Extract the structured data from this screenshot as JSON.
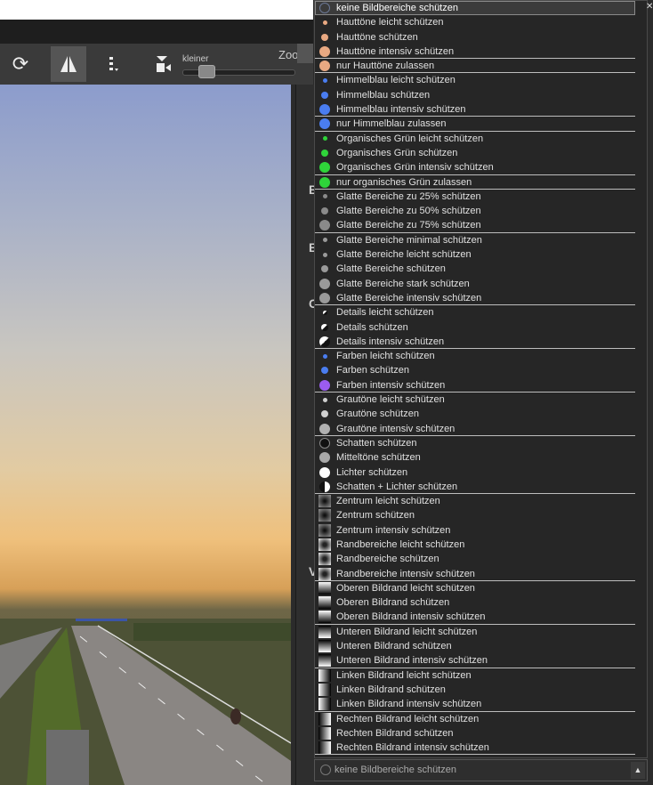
{
  "toolbar": {
    "slider_label": "kleiner",
    "zoom_label": "Zoo"
  },
  "side_letters": [
    "B",
    "E",
    "C",
    "V"
  ],
  "dropdown": {
    "selected_index": 0,
    "items": [
      {
        "label": "keine Bildbereiche schützen",
        "icon": "none-icon",
        "color": "#6b7896",
        "sep": true
      },
      {
        "label": "Hauttöne leicht schützen",
        "icon": "skin-small-icon",
        "color": "#e9a982"
      },
      {
        "label": "Hauttöne schützen",
        "icon": "skin-medium-icon",
        "color": "#e9a982"
      },
      {
        "label": "Hauttöne intensiv schützen",
        "icon": "skin-large-icon",
        "color": "#e9a982",
        "sep": true
      },
      {
        "label": "nur Hauttöne zulassen",
        "icon": "skin-only-icon",
        "color": "#e9a982",
        "sep": true
      },
      {
        "label": "Himmelblau leicht schützen",
        "icon": "sky-small-icon",
        "color": "#4a7df0"
      },
      {
        "label": "Himmelblau schützen",
        "icon": "sky-medium-icon",
        "color": "#4a7df0"
      },
      {
        "label": "Himmelblau intensiv schützen",
        "icon": "sky-large-icon",
        "color": "#4a7df0",
        "sep": true
      },
      {
        "label": "nur Himmelblau zulassen",
        "icon": "sky-only-icon",
        "color": "#4a7df0",
        "sep": true
      },
      {
        "label": "Organisches Grün leicht schützen",
        "icon": "green-small-icon",
        "color": "#2fd43a"
      },
      {
        "label": "Organisches Grün schützen",
        "icon": "green-medium-icon",
        "color": "#2fd43a"
      },
      {
        "label": "Organisches Grün intensiv schützen",
        "icon": "green-large-icon",
        "color": "#2fd43a",
        "sep": true
      },
      {
        "label": "nur organisches Grün zulassen",
        "icon": "green-only-icon",
        "color": "#2fd43a",
        "sep": true
      },
      {
        "label": "Glatte Bereiche zu 25% schützen",
        "icon": "smooth-25-icon",
        "color": "#8a8a8a"
      },
      {
        "label": "Glatte Bereiche zu 50% schützen",
        "icon": "smooth-50-icon",
        "color": "#8a8a8a"
      },
      {
        "label": "Glatte Bereiche zu 75% schützen",
        "icon": "smooth-75-icon",
        "color": "#8a8a8a",
        "sep": true
      },
      {
        "label": "Glatte Bereiche minimal schützen",
        "icon": "smooth-min-icon",
        "color": "#9a9a9a"
      },
      {
        "label": "Glatte Bereiche leicht schützen",
        "icon": "smooth-light-icon",
        "color": "#9a9a9a"
      },
      {
        "label": "Glatte Bereiche schützen",
        "icon": "smooth-icon",
        "color": "#9a9a9a"
      },
      {
        "label": "Glatte Bereiche stark schützen",
        "icon": "smooth-strong-icon",
        "color": "#9a9a9a"
      },
      {
        "label": "Glatte Bereiche intensiv schützen",
        "icon": "smooth-intense-icon",
        "color": "#9a9a9a",
        "sep": true
      },
      {
        "label": "Details leicht schützen",
        "icon": "details-small-icon",
        "color": "#f0f0f0"
      },
      {
        "label": "Details schützen",
        "icon": "details-medium-icon",
        "color": "#f0f0f0"
      },
      {
        "label": "Details intensiv schützen",
        "icon": "details-large-icon",
        "color": "#f0f0f0",
        "sep": true
      },
      {
        "label": "Farben leicht schützen",
        "icon": "colors-small-icon",
        "color": "#4a7df0"
      },
      {
        "label": "Farben schützen",
        "icon": "colors-medium-icon",
        "color": "#4a7df0"
      },
      {
        "label": "Farben intensiv schützen",
        "icon": "colors-large-icon",
        "color": "#9b5cf0",
        "sep": true
      },
      {
        "label": "Grautöne leicht schützen",
        "icon": "gray-small-icon",
        "color": "#d0d0d0"
      },
      {
        "label": "Grautöne schützen",
        "icon": "gray-medium-icon",
        "color": "#d0d0d0"
      },
      {
        "label": "Grautöne intensiv schützen",
        "icon": "gray-large-icon",
        "color": "#b0b0b0",
        "sep": true
      },
      {
        "label": "Schatten schützen",
        "icon": "shadows-icon",
        "color": "#111111"
      },
      {
        "label": "Mitteltöne schützen",
        "icon": "midtones-icon",
        "color": "#a8a8a8"
      },
      {
        "label": "Lichter schützen",
        "icon": "highlights-icon",
        "color": "#ffffff"
      },
      {
        "label": "Schatten + Lichter schützen",
        "icon": "shadows-highlights-icon",
        "color": "#ffffff",
        "sep": true
      },
      {
        "label": "Zentrum leicht schützen",
        "icon": "center-small-icon",
        "color": "#444444"
      },
      {
        "label": "Zentrum schützen",
        "icon": "center-medium-icon",
        "color": "#444444"
      },
      {
        "label": "Zentrum intensiv schützen",
        "icon": "center-large-icon",
        "color": "#444444"
      },
      {
        "label": "Randbereiche leicht schützen",
        "icon": "edges-small-icon",
        "color": "#999999"
      },
      {
        "label": "Randbereiche schützen",
        "icon": "edges-medium-icon",
        "color": "#999999"
      },
      {
        "label": "Randbereiche intensiv schützen",
        "icon": "edges-large-icon",
        "color": "#999999",
        "sep": true
      },
      {
        "label": "Oberen Bildrand leicht schützen",
        "icon": "top-edge-small-icon",
        "color": "#ffffff"
      },
      {
        "label": "Oberen Bildrand schützen",
        "icon": "top-edge-medium-icon",
        "color": "#ffffff"
      },
      {
        "label": "Oberen Bildrand intensiv schützen",
        "icon": "top-edge-large-icon",
        "color": "#ffffff",
        "sep": true
      },
      {
        "label": "Unteren Bildrand leicht schützen",
        "icon": "bottom-edge-small-icon",
        "color": "#ffffff"
      },
      {
        "label": "Unteren Bildrand schützen",
        "icon": "bottom-edge-medium-icon",
        "color": "#ffffff"
      },
      {
        "label": "Unteren Bildrand intensiv schützen",
        "icon": "bottom-edge-large-icon",
        "color": "#ffffff",
        "sep": true
      },
      {
        "label": "Linken Bildrand leicht schützen",
        "icon": "left-edge-small-icon",
        "color": "#ffffff"
      },
      {
        "label": "Linken Bildrand schützen",
        "icon": "left-edge-medium-icon",
        "color": "#ffffff"
      },
      {
        "label": "Linken Bildrand intensiv schützen",
        "icon": "left-edge-large-icon",
        "color": "#ffffff",
        "sep": true
      },
      {
        "label": "Rechten Bildrand leicht schützen",
        "icon": "right-edge-small-icon",
        "color": "#ffffff"
      },
      {
        "label": "Rechten Bildrand schützen",
        "icon": "right-edge-medium-icon",
        "color": "#ffffff"
      },
      {
        "label": "Rechten Bildrand intensiv schützen",
        "icon": "right-edge-large-icon",
        "color": "#ffffff",
        "sep": true
      }
    ]
  },
  "combo": {
    "value": "keine Bildbereiche schützen"
  }
}
